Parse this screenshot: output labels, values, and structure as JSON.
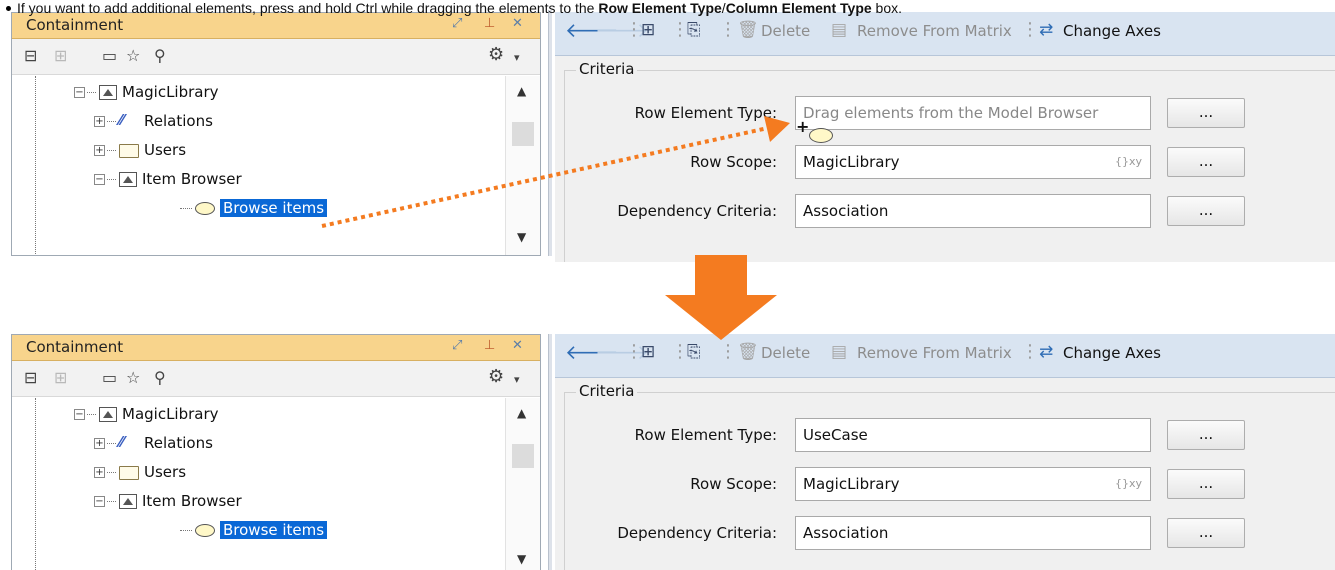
{
  "note": {
    "prefix": "If you want to add additional elements, press and hold Ctrl while dragging the elements to the ",
    "row_type": "Row Element Type",
    "slash": "/",
    "col_type": "Column Element Type",
    "suffix": " box."
  },
  "containment": {
    "title": "Containment",
    "window_controls": [
      "restore-icon",
      "pin-icon",
      "close-icon"
    ],
    "toolbar_icons": [
      "collapse-all-icon",
      "expand-all-icon",
      "open-folder-icon",
      "favorite-star-icon",
      "search-icon",
      "settings-gear-icon",
      "dropdown-icon"
    ],
    "tree": [
      {
        "label": "MagicLibrary",
        "icon": "package-icon",
        "expander": "−"
      },
      {
        "label": "Relations",
        "icon": "relations-icon",
        "expander": "+"
      },
      {
        "label": "Users",
        "icon": "folder-icon",
        "expander": "+"
      },
      {
        "label": "Item Browser",
        "icon": "package-icon",
        "expander": "−"
      },
      {
        "label": "Browse items",
        "icon": "use-case-icon",
        "selected": true
      }
    ]
  },
  "matrix": {
    "toolbar": {
      "delete": "Delete",
      "remove": "Remove From Matrix",
      "change_axes": "Change Axes"
    },
    "criteria_legend": "Criteria",
    "fields": {
      "row_type_label": "Row Element Type:",
      "row_scope_label": "Row Scope:",
      "dep_criteria_label": "Dependency Criteria:",
      "ellipsis": "..."
    },
    "before": {
      "row_type_placeholder": "Drag elements from the Model Browser",
      "row_scope": "MagicLibrary",
      "dep_criteria": "Association",
      "expr_marker": "{}xy"
    },
    "after": {
      "row_type": "UseCase",
      "row_scope": "MagicLibrary",
      "dep_criteria": "Association",
      "expr_marker": "{}xy"
    }
  },
  "colors": {
    "drag_arrow": "#f47b20",
    "selection": "#0a68d6",
    "title_bar": "#f8d48c"
  }
}
